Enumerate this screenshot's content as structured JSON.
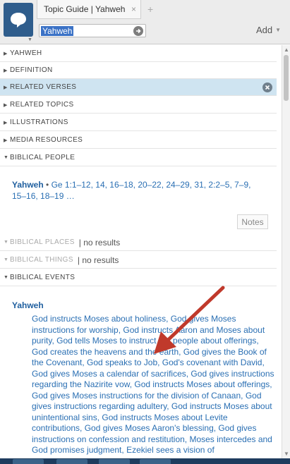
{
  "tab": {
    "title": "Topic Guide | Yahweh",
    "close": "×",
    "new": "+"
  },
  "search": {
    "value": "Yahweh"
  },
  "toolbar": {
    "add_label": "Add"
  },
  "colors": {
    "accent": "#2f5d8c",
    "link": "#2a6fb3",
    "active_row": "#cfe4f1",
    "arrow": "#c0392b"
  },
  "sections": {
    "yahweh": "YAHWEH",
    "definition": "DEFINITION",
    "related_verses": "RELATED VERSES",
    "related_topics": "RELATED TOPICS",
    "illustrations": "ILLUSTRATIONS",
    "media_resources": "MEDIA RESOURCES",
    "biblical_people": "BIBLICAL PEOPLE",
    "biblical_places": "BIBLICAL PLACES",
    "biblical_things": "BIBLICAL THINGS",
    "biblical_events": "BIBLICAL EVENTS"
  },
  "no_results": "| no results",
  "people": {
    "name": "Yahweh",
    "bullet": " • ",
    "refs": "Ge 1:1–12, 14, 16–18, 20–22, 24–29, 31, 2:2–5, 7–9, 15–16, 18–19 …"
  },
  "notes_label": "Notes",
  "events": {
    "name": "Yahweh",
    "text": "God instructs Moses about holiness, God gives Moses instructions for worship, God instructs Aaron and Moses about purity, God tells Moses to instruct the people about offerings, God creates the heavens and the earth, God gives the Book of the Covenant, God speaks to Job, God's covenant with David, God gives Moses a calendar of sacrifices, God gives instructions regarding the Nazirite vow, God instructs Moses about offerings, God gives Moses instructions for the division of Canaan, God gives instructions regarding adultery, God instructs Moses about unintentional sins, God instructs Moses about Levite contributions, God gives Moses Aaron's blessing, God gives instructions on confession and restitution, Moses intercedes and God promises judgment, Ezekiel sees a vision of"
  }
}
